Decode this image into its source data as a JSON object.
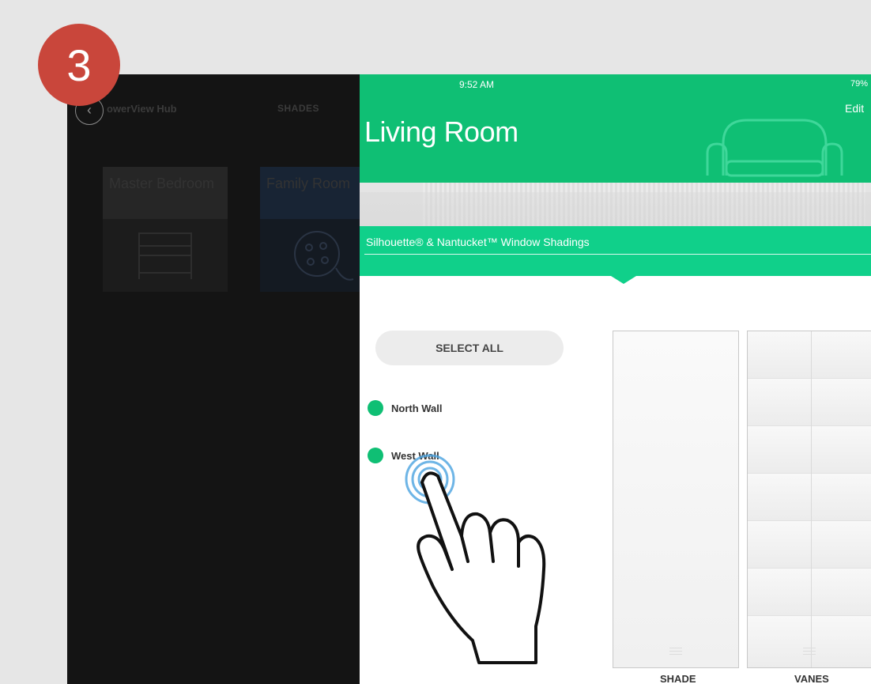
{
  "step_badge": "3",
  "theme": {
    "accent_green": "#0fbf74",
    "badge_red": "#c9463b",
    "page_bg": "#e6e6e6"
  },
  "background_app": {
    "back_icon": "chevron-left-icon",
    "hub_title": "owerView Hub",
    "section_title": "SHADES",
    "rooms": [
      {
        "name": "Master Bedroom",
        "icon": "bed-icon"
      },
      {
        "name": "Family Room",
        "icon": "family-room-icon"
      }
    ]
  },
  "status_bar": {
    "time": "9:52 AM",
    "battery": "79%"
  },
  "header": {
    "room_title": "Living Room",
    "edit_label": "Edit",
    "room_icon": "sofa-icon"
  },
  "product": {
    "label": "Silhouette® & Nantucket™ Window Shadings"
  },
  "controls": {
    "select_all_label": "SELECT ALL",
    "shades": [
      {
        "name": "North Wall",
        "selected": true
      },
      {
        "name": "West Wall",
        "selected": true
      }
    ],
    "shade_label": "SHADE",
    "vanes_label": "VANES"
  },
  "overlay": {
    "gesture_icon": "tap-hand-icon"
  }
}
